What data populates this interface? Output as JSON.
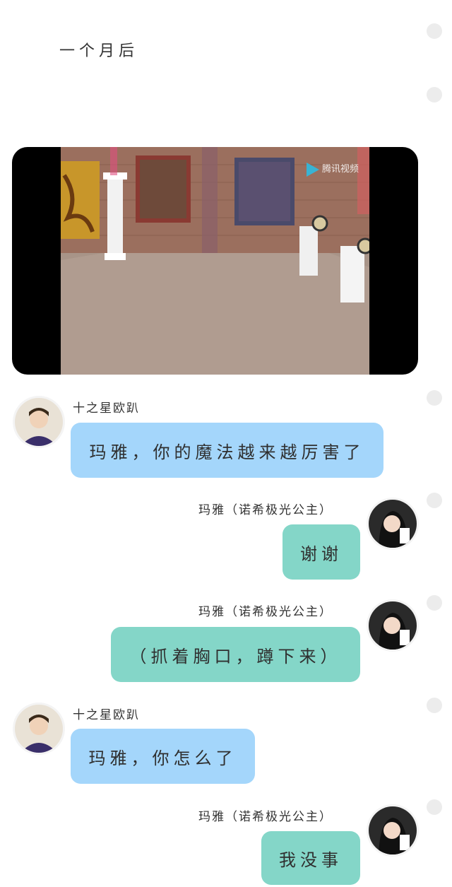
{
  "narration": "一个月后",
  "video": {
    "watermark": "腾讯视频"
  },
  "messages": [
    {
      "side": "left",
      "sender": "十之星欧趴",
      "text": "玛雅，你的魔法越来越厉害了"
    },
    {
      "side": "right",
      "sender": "玛雅（诺希极光公主）",
      "text": "谢谢"
    },
    {
      "side": "right",
      "sender": "玛雅（诺希极光公主）",
      "text": "（抓着胸口，蹲下来）"
    },
    {
      "side": "left",
      "sender": "十之星欧趴",
      "text": "玛雅，你怎么了"
    },
    {
      "side": "right",
      "sender": "玛雅（诺希极光公主）",
      "text": "我没事"
    }
  ],
  "colors": {
    "left_bubble": "#a4d6fb",
    "right_bubble": "#84d6c8",
    "background": "#ffffff"
  }
}
